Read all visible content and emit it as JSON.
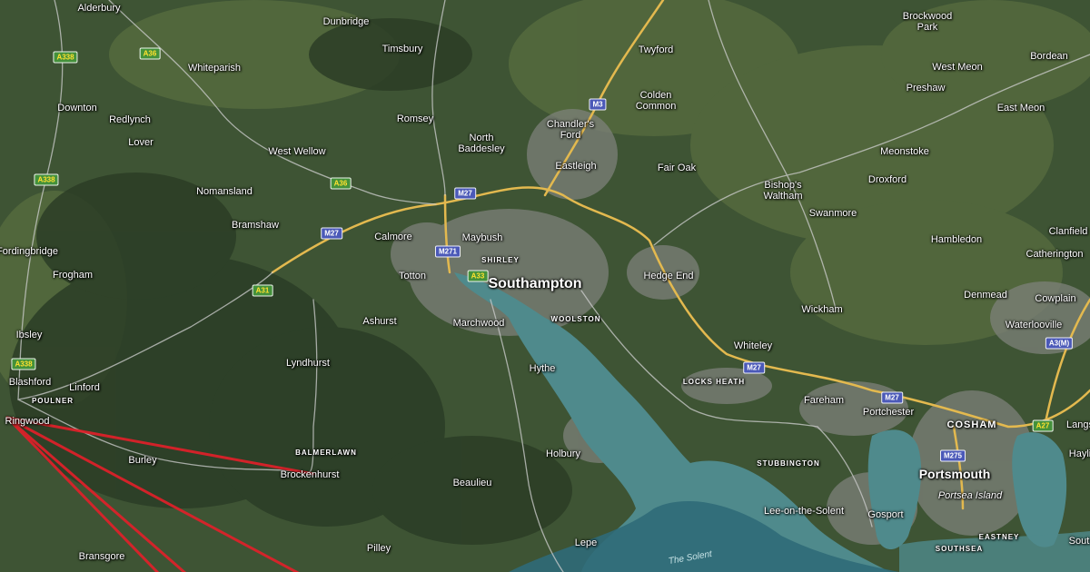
{
  "map": {
    "places": [
      {
        "id": "alderbury",
        "name": "Alderbury"
      },
      {
        "id": "dunbridge",
        "name": "Dunbridge"
      },
      {
        "id": "timsbury",
        "name": "Timsbury"
      },
      {
        "id": "twyford",
        "name": "Twyford"
      },
      {
        "id": "brockwood-park",
        "name": "Brockwood\nPark"
      },
      {
        "id": "whiteparish",
        "name": "Whiteparish"
      },
      {
        "id": "west-meon",
        "name": "West Meon"
      },
      {
        "id": "bordean",
        "name": "Bordean"
      },
      {
        "id": "preshaw",
        "name": "Preshaw"
      },
      {
        "id": "downton",
        "name": "Downton"
      },
      {
        "id": "colden-common",
        "name": "Colden\nCommon"
      },
      {
        "id": "east-meon",
        "name": "East Meon"
      },
      {
        "id": "redlynch",
        "name": "Redlynch"
      },
      {
        "id": "romsey",
        "name": "Romsey"
      },
      {
        "id": "chandlers-ford",
        "name": "Chandler's\nFord"
      },
      {
        "id": "north-baddesley",
        "name": "North\nBaddesley"
      },
      {
        "id": "lover",
        "name": "Lover"
      },
      {
        "id": "west-wellow",
        "name": "West Wellow"
      },
      {
        "id": "meonstoke",
        "name": "Meonstoke"
      },
      {
        "id": "eastleigh",
        "name": "Eastleigh"
      },
      {
        "id": "fair-oak",
        "name": "Fair Oak"
      },
      {
        "id": "bishops-waltham",
        "name": "Bishop's\nWaltham"
      },
      {
        "id": "droxford",
        "name": "Droxford"
      },
      {
        "id": "nomansland",
        "name": "Nomansland"
      },
      {
        "id": "swanmore",
        "name": "Swanmore"
      },
      {
        "id": "bramshaw",
        "name": "Bramshaw"
      },
      {
        "id": "clanfield",
        "name": "Clanfield"
      },
      {
        "id": "calmore",
        "name": "Calmore"
      },
      {
        "id": "maybush",
        "name": "Maybush"
      },
      {
        "id": "hambledon",
        "name": "Hambledon"
      },
      {
        "id": "fordingbridge",
        "name": "Fordingbridge"
      },
      {
        "id": "catherington",
        "name": "Catherington"
      },
      {
        "id": "shirley",
        "name": "SHIRLEY"
      },
      {
        "id": "frogham",
        "name": "Frogham"
      },
      {
        "id": "totton",
        "name": "Totton"
      },
      {
        "id": "hedge-end",
        "name": "Hedge End"
      },
      {
        "id": "southampton",
        "name": "Southampton"
      },
      {
        "id": "denmead",
        "name": "Denmead"
      },
      {
        "id": "cowplain",
        "name": "Cowplain"
      },
      {
        "id": "wickham",
        "name": "Wickham"
      },
      {
        "id": "ashurst",
        "name": "Ashurst"
      },
      {
        "id": "woolston",
        "name": "WOOLSTON"
      },
      {
        "id": "marchwood",
        "name": "Marchwood"
      },
      {
        "id": "waterlooville",
        "name": "Waterlooville"
      },
      {
        "id": "ibsley",
        "name": "Ibsley"
      },
      {
        "id": "whiteley",
        "name": "Whiteley"
      },
      {
        "id": "lyndhurst",
        "name": "Lyndhurst"
      },
      {
        "id": "hythe",
        "name": "Hythe"
      },
      {
        "id": "blashford",
        "name": "Blashford"
      },
      {
        "id": "locks-heath",
        "name": "LOCKS HEATH"
      },
      {
        "id": "linford",
        "name": "Linford"
      },
      {
        "id": "fareham",
        "name": "Fareham"
      },
      {
        "id": "poulner",
        "name": "POULNER"
      },
      {
        "id": "portchester",
        "name": "Portchester"
      },
      {
        "id": "langs",
        "name": "Langs"
      },
      {
        "id": "ringwood",
        "name": "Ringwood"
      },
      {
        "id": "cosham",
        "name": "COSHAM"
      },
      {
        "id": "balmerlawn",
        "name": "BALMERLAWN"
      },
      {
        "id": "holbury",
        "name": "Holbury"
      },
      {
        "id": "hayli",
        "name": "Hayli"
      },
      {
        "id": "burley",
        "name": "Burley"
      },
      {
        "id": "stubbington",
        "name": "STUBBINGTON"
      },
      {
        "id": "brockenhurst",
        "name": "Brockenhurst"
      },
      {
        "id": "portsmouth",
        "name": "Portsmouth"
      },
      {
        "id": "beaulieu",
        "name": "Beaulieu"
      },
      {
        "id": "portsea-island",
        "name": "Portsea Island"
      },
      {
        "id": "lee-on-the-solent",
        "name": "Lee-on-the-Solent"
      },
      {
        "id": "gosport",
        "name": "Gosport"
      },
      {
        "id": "eastney",
        "name": "EASTNEY"
      },
      {
        "id": "lepe",
        "name": "Lepe"
      },
      {
        "id": "bransgore",
        "name": "Bransgore"
      },
      {
        "id": "pilley",
        "name": "Pilley"
      },
      {
        "id": "southsea",
        "name": "SOUTHSEA"
      },
      {
        "id": "sout",
        "name": "Sout"
      }
    ],
    "water_labels": [
      {
        "id": "the-solent",
        "name": "The Solent"
      }
    ],
    "road_shields": [
      {
        "id": "a338-north",
        "ref": "A338",
        "kind": "primary"
      },
      {
        "id": "a36-west",
        "ref": "A36",
        "kind": "primary"
      },
      {
        "id": "a338-mid",
        "ref": "A338",
        "kind": "primary"
      },
      {
        "id": "a36-east",
        "ref": "A36",
        "kind": "primary"
      },
      {
        "id": "m3",
        "ref": "M3",
        "kind": "motorway"
      },
      {
        "id": "m27-north",
        "ref": "M27",
        "kind": "motorway"
      },
      {
        "id": "m27-west",
        "ref": "M27",
        "kind": "motorway"
      },
      {
        "id": "m271",
        "ref": "M271",
        "kind": "motorway"
      },
      {
        "id": "a33",
        "ref": "A33",
        "kind": "primary"
      },
      {
        "id": "a31",
        "ref": "A31",
        "kind": "primary"
      },
      {
        "id": "a338-south",
        "ref": "A338",
        "kind": "primary"
      },
      {
        "id": "m27-east",
        "ref": "M27",
        "kind": "motorway"
      },
      {
        "id": "m27-fareham",
        "ref": "M27",
        "kind": "motorway"
      },
      {
        "id": "a3m",
        "ref": "A3(M)",
        "kind": "motorway"
      },
      {
        "id": "a27",
        "ref": "A27",
        "kind": "primary"
      },
      {
        "id": "m275",
        "ref": "M275",
        "kind": "motorway"
      }
    ],
    "colors": {
      "land": "#3e5434",
      "forest": "#2b3d26",
      "farmland": "#566b3e",
      "urban": "#7d817a",
      "water": "#4f8a8c",
      "deep_water": "#2f6a78",
      "motorway": "#e3b94f",
      "road": "#cfcfcf",
      "route": "#e0202a"
    }
  }
}
